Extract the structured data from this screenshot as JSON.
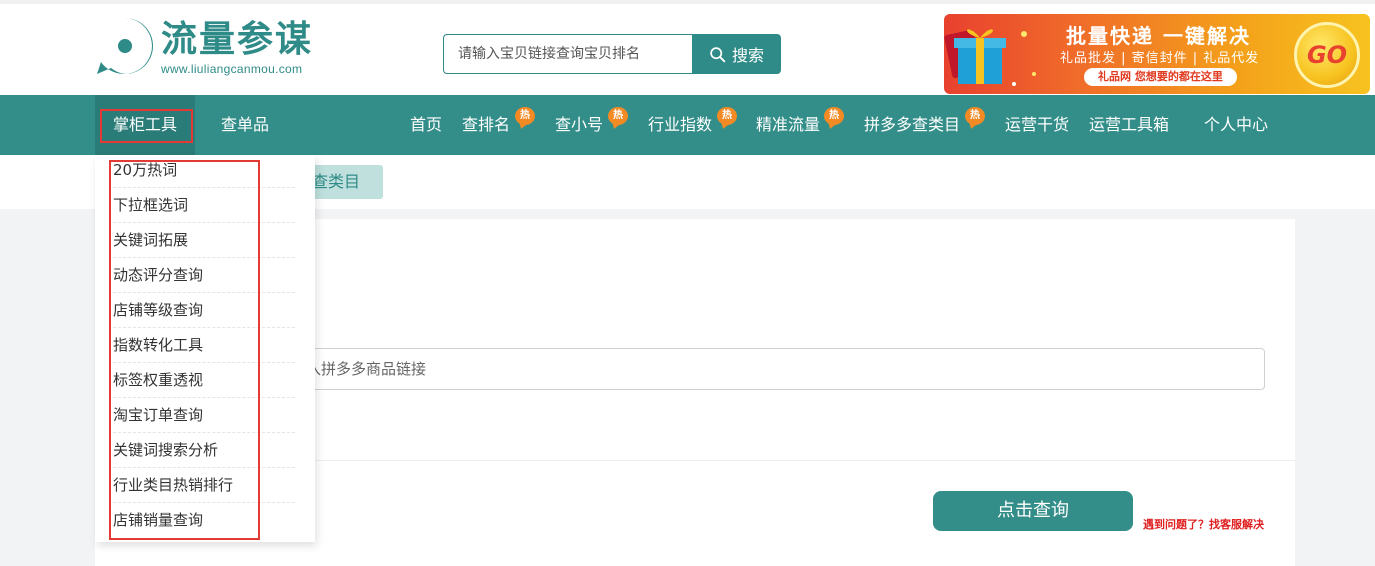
{
  "header": {
    "logo_title": "流量参谋",
    "logo_url": "www.liuliangcanmou.com",
    "search_placeholder": "请输入宝贝链接查询宝贝排名",
    "search_button": "搜索"
  },
  "banner": {
    "line1": "批量快递 一键解决",
    "line2": "礼品批发 | 寄信封件 | 礼品代发",
    "line3": "礼品网 您想要的都在这里",
    "go": "GO"
  },
  "nav": {
    "items": [
      {
        "label": "掌柜工具",
        "hot": false
      },
      {
        "label": "查单品",
        "hot": false
      },
      {
        "label": "首页",
        "hot": false
      },
      {
        "label": "查排名",
        "hot": true
      },
      {
        "label": "查小号",
        "hot": true
      },
      {
        "label": "行业指数",
        "hot": true
      },
      {
        "label": "精准流量",
        "hot": true
      },
      {
        "label": "拼多多查类目",
        "hot": true
      },
      {
        "label": "运营干货",
        "hot": false
      },
      {
        "label": "运营工具箱",
        "hot": false
      },
      {
        "label": "个人中心",
        "hot": false
      }
    ],
    "hot_label": "热"
  },
  "dropdown": {
    "items": [
      "20万热词",
      "下拉框选词",
      "关键词拓展",
      "动态评分查询",
      "店铺等级查询",
      "指数转化工具",
      "标签权重透视",
      "淘宝订单查询",
      "关键词搜索分析",
      "行业类目热销排行",
      "店铺销量查询"
    ]
  },
  "page": {
    "subtab": "查类目",
    "link_placeholder": "入拼多多商品链接",
    "query_button": "点击查询",
    "help_link": "遇到问题了？找客服解决"
  },
  "colors": {
    "brand": "#338e89",
    "hot_badge": "#f38a24",
    "highlight_box": "#e53935",
    "help_link": "#e02020"
  }
}
